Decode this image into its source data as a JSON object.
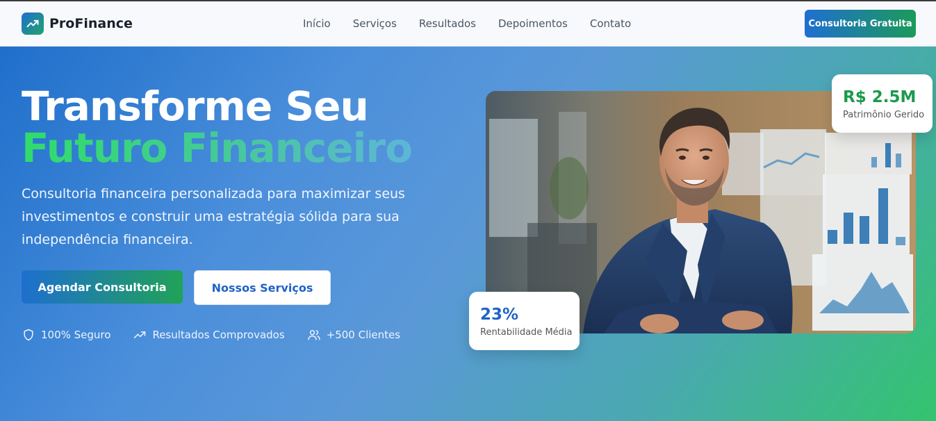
{
  "brand": {
    "name": "ProFinance",
    "logo_icon": "trending-up-icon"
  },
  "nav": {
    "items": [
      {
        "label": "Início"
      },
      {
        "label": "Serviços"
      },
      {
        "label": "Resultados"
      },
      {
        "label": "Depoimentos"
      },
      {
        "label": "Contato"
      }
    ]
  },
  "header": {
    "cta_label": "Consultoria Gratuita"
  },
  "hero": {
    "title_line1": "Transforme Seu",
    "title_line2": "Futuro Financeiro",
    "description": "Consultoria financeira personalizada para maximizar seus investimentos e construir uma estratégia sólida para sua independência financeira.",
    "primary_button": "Agendar Consultoria",
    "secondary_button": "Nossos Serviços",
    "features": [
      {
        "icon": "shield-icon",
        "label": "100% Seguro"
      },
      {
        "icon": "trending-up-icon",
        "label": "Resultados Comprovados"
      },
      {
        "icon": "users-icon",
        "label": "+500 Clientes"
      }
    ]
  },
  "stats": {
    "top": {
      "value": "R$ 2.5M",
      "label": "Patrimônio Gerido"
    },
    "bottom": {
      "value": "23%",
      "label": "Rentabilidade Média"
    }
  },
  "colors": {
    "brand_blue": "#1f6fcf",
    "brand_green": "#21a257",
    "stat_green": "#1c9a4c",
    "stat_blue": "#1f63c6"
  }
}
